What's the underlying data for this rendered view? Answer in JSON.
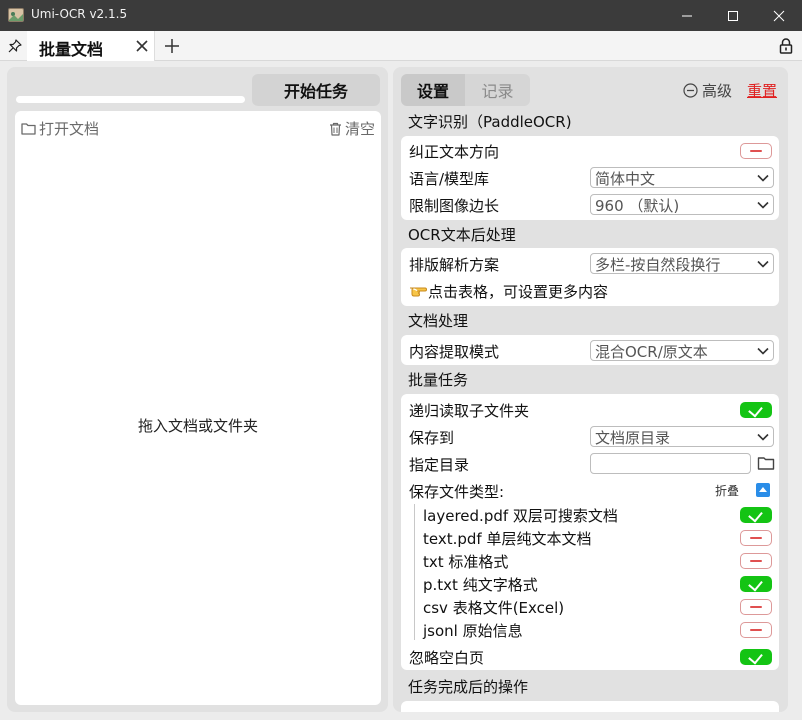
{
  "window": {
    "title": "Umi-OCR v2.1.5"
  },
  "tabs": {
    "active_label": "批量文档"
  },
  "left": {
    "start_button": "开始任务",
    "open_docs": "打开文档",
    "clear": "清空",
    "drop_hint": "拖入文档或文件夹",
    "progress": 0
  },
  "right": {
    "tab_settings": "设置",
    "tab_records": "记录",
    "advanced": "高级",
    "reset": "重置",
    "sections": {
      "ocr": "文字识别（PaddleOCR)",
      "post": "OCR文本后处理",
      "doc": "文档处理",
      "batch": "批量任务",
      "after": "任务完成后的操作"
    },
    "ocr": {
      "correct_direction": {
        "label": "纠正文本方向",
        "on": false
      },
      "language": {
        "label": "语言/模型库",
        "value": "简体中文"
      },
      "limit_side": {
        "label": "限制图像边长",
        "value": "960 （默认)"
      }
    },
    "post": {
      "layout": {
        "label": "排版解析方案",
        "value": "多栏-按自然段换行"
      },
      "hint": "点击表格，可设置更多内容"
    },
    "doc": {
      "extract_mode": {
        "label": "内容提取模式",
        "value": "混合OCR/原文本"
      }
    },
    "batch": {
      "recursive": {
        "label": "递归读取子文件夹",
        "on": true
      },
      "save_to": {
        "label": "保存到",
        "value": "文档原目录"
      },
      "target_dir": {
        "label": "指定目录",
        "value": ""
      },
      "file_types": {
        "label": "保存文件类型:",
        "collapse": "折叠",
        "items": [
          {
            "label": "layered.pdf 双层可搜索文档",
            "on": true
          },
          {
            "label": "text.pdf 单层纯文本文档",
            "on": false
          },
          {
            "label": "txt 标准格式",
            "on": false
          },
          {
            "label": "p.txt 纯文字格式",
            "on": true
          },
          {
            "label": "csv 表格文件(Excel)",
            "on": false
          },
          {
            "label": "jsonl 原始信息",
            "on": false
          }
        ]
      },
      "ignore_blank": {
        "label": "忽略空白页",
        "on": true
      }
    }
  },
  "icons": {
    "app": "app-icon",
    "minimize": "minimize-icon",
    "maximize": "maximize-icon",
    "close": "close-icon",
    "pin": "pin-icon",
    "lock": "lock-icon",
    "folder": "folder-icon",
    "trash": "trash-icon",
    "hand": "pointing-hand-icon"
  },
  "colors": {
    "titlebar": "#3b3b3b",
    "toggle_on": "#14c414",
    "reset": "#e02020",
    "collapse_icon": "#2a8de8"
  }
}
